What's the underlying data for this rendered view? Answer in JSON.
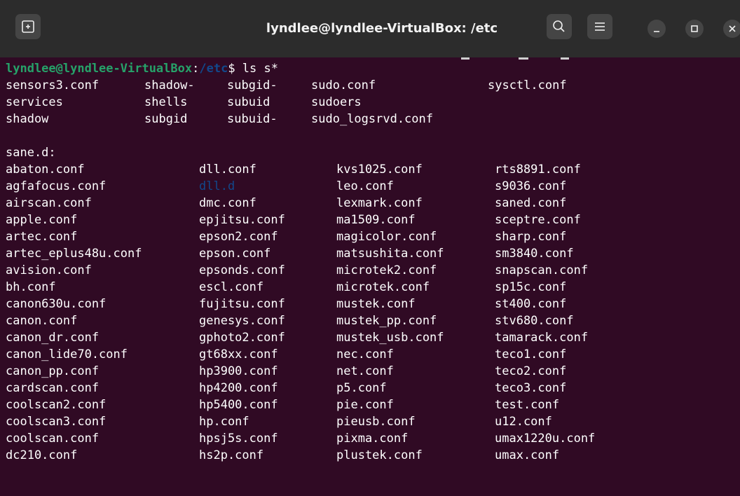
{
  "window": {
    "title": "lyndlee@lyndlee-VirtualBox: /etc"
  },
  "icons": {
    "new_tab": "new-tab-plus-icon",
    "search": "search-icon",
    "menu": "hamburger-menu-icon",
    "minimize": "minimize-icon",
    "maximize": "maximize-icon",
    "close": "close-icon"
  },
  "colors": {
    "terminal_bg": "#300a24",
    "titlebar_bg": "#2c2c2c",
    "user_host": "#26a269",
    "path_dir": "#12488b"
  },
  "terminal": {
    "prompt": {
      "user_host": "lyndlee@lyndlee-VirtualBox",
      "sep": ":",
      "path": "/etc",
      "symbol": "$",
      "command": " ls s*"
    },
    "etc_rows": [
      [
        "sensors3.conf",
        "shadow-",
        "subgid-",
        "sudo.conf",
        "sysctl.conf"
      ],
      [
        "services",
        "shells",
        "subuid",
        "sudoers",
        ""
      ],
      [
        "shadow",
        "subgid",
        "subuid-",
        "sudo_logsrvd.conf",
        ""
      ]
    ],
    "sane_header": "sane.d:",
    "sane_rows": [
      [
        "abaton.conf",
        "dll.conf",
        "kvs1025.conf",
        "rts8891.conf"
      ],
      [
        "agfafocus.conf",
        "dll.d",
        "leo.conf",
        "s9036.conf"
      ],
      [
        "airscan.conf",
        "dmc.conf",
        "lexmark.conf",
        "saned.conf"
      ],
      [
        "apple.conf",
        "epjitsu.conf",
        "ma1509.conf",
        "sceptre.conf"
      ],
      [
        "artec.conf",
        "epson2.conf",
        "magicolor.conf",
        "sharp.conf"
      ],
      [
        "artec_eplus48u.conf",
        "epson.conf",
        "matsushita.conf",
        "sm3840.conf"
      ],
      [
        "avision.conf",
        "epsonds.conf",
        "microtek2.conf",
        "snapscan.conf"
      ],
      [
        "bh.conf",
        "escl.conf",
        "microtek.conf",
        "sp15c.conf"
      ],
      [
        "canon630u.conf",
        "fujitsu.conf",
        "mustek.conf",
        "st400.conf"
      ],
      [
        "canon.conf",
        "genesys.conf",
        "mustek_pp.conf",
        "stv680.conf"
      ],
      [
        "canon_dr.conf",
        "gphoto2.conf",
        "mustek_usb.conf",
        "tamarack.conf"
      ],
      [
        "canon_lide70.conf",
        "gt68xx.conf",
        "nec.conf",
        "teco1.conf"
      ],
      [
        "canon_pp.conf",
        "hp3900.conf",
        "net.conf",
        "teco2.conf"
      ],
      [
        "cardscan.conf",
        "hp4200.conf",
        "p5.conf",
        "teco3.conf"
      ],
      [
        "coolscan2.conf",
        "hp5400.conf",
        "pie.conf",
        "test.conf"
      ],
      [
        "coolscan3.conf",
        "hp.conf",
        "pieusb.conf",
        "u12.conf"
      ],
      [
        "coolscan.conf",
        "hpsj5s.conf",
        "pixma.conf",
        "umax1220u.conf"
      ],
      [
        "dc210.conf",
        "hs2p.conf",
        "plustek.conf",
        "umax.conf"
      ]
    ]
  }
}
